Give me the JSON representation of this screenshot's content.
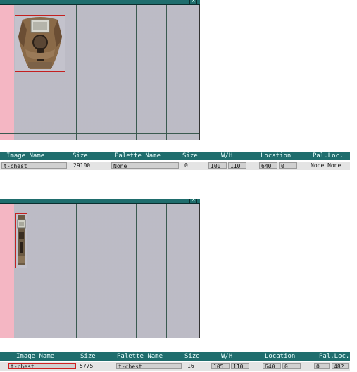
{
  "panel1": {
    "close_glyph": "x",
    "sprite_icon": "chest-armor-icon",
    "headers": [
      "Image Name",
      "Size",
      "Palette Name",
      "Size",
      "W/H",
      "Location",
      "Pal.Loc."
    ],
    "image_name": "t-chest",
    "size": "29100",
    "palette_name": "None",
    "pal_size": "0",
    "width": "100",
    "height": "110",
    "loc_x": "640",
    "loc_y": "0",
    "pal_loc": "None None"
  },
  "panel2": {
    "close_glyph": "x",
    "sprite_icon": "belt-strap-icon",
    "headers": [
      "Image Name",
      "Size",
      "Palette Name",
      "Size",
      "W/H",
      "Location",
      "Pal.Loc."
    ],
    "image_name": "t-chest",
    "size": "5775",
    "palette_name": "t-chest",
    "pal_size": "16",
    "width": "105",
    "height": "110",
    "loc_x": "640",
    "loc_y": "0",
    "pal_loc_a": "0",
    "pal_loc_b": "482"
  }
}
